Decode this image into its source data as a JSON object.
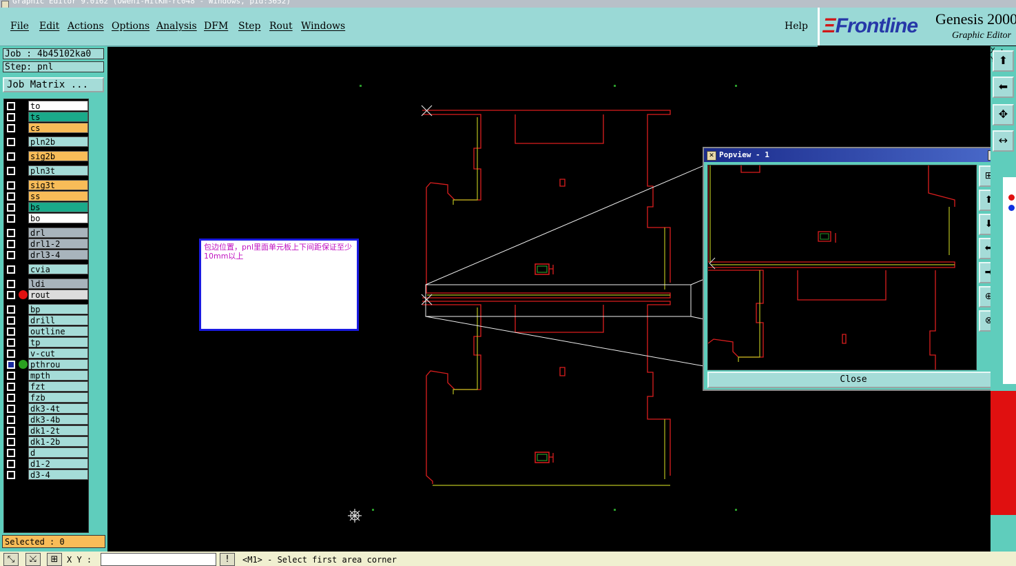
{
  "window": {
    "title": "Graphic Editor 9.0162 (Owen1-HitKm-rc048 - Windows, pid:3652)"
  },
  "menu": {
    "items": [
      "File",
      "Edit",
      "Actions",
      "Options",
      "Analysis",
      "DFM",
      "Step",
      "Rout",
      "Windows"
    ],
    "help": "Help"
  },
  "brand": {
    "logo": "Frontline",
    "product": "Genesis 2000",
    "subtitle": "Graphic Editor"
  },
  "left": {
    "job": "Job : 4b45102ka0",
    "step": "Step: pnl",
    "job_matrix": "Job Matrix ...",
    "selected": "Selected : 0"
  },
  "layers": [
    {
      "name": "to",
      "color": "#ffffff"
    },
    {
      "name": "ts",
      "color": "#1aaa8a"
    },
    {
      "name": "cs",
      "color": "#f8bc58"
    },
    {
      "name": "pln2b",
      "color": "#a5dcd8"
    },
    {
      "name": "sig2b",
      "color": "#f8bc58"
    },
    {
      "name": "pln3t",
      "color": "#a5dcd8"
    },
    {
      "name": "sig3t",
      "color": "#f8bc58"
    },
    {
      "name": "ss",
      "color": "#f8bc58"
    },
    {
      "name": "bs",
      "color": "#1aaa8a"
    },
    {
      "name": "bo",
      "color": "#ffffff"
    },
    {
      "name": "drl",
      "color": "#a8b4bc"
    },
    {
      "name": "drl1-2",
      "color": "#a8b4bc"
    },
    {
      "name": "drl3-4",
      "color": "#a8b4bc"
    },
    {
      "name": "cvia",
      "color": "#a5dcd8"
    },
    {
      "name": "ldi",
      "color": "#a8b4bc"
    },
    {
      "name": "rout",
      "color": "#dcdcdc",
      "dot": "#e01010"
    },
    {
      "name": "bp",
      "color": "#a5dcd8"
    },
    {
      "name": "drill",
      "color": "#a5dcd8"
    },
    {
      "name": "outline",
      "color": "#a5dcd8"
    },
    {
      "name": "tp",
      "color": "#a5dcd8"
    },
    {
      "name": "v-cut",
      "color": "#a5dcd8"
    },
    {
      "name": "pthrou",
      "color": "#a5dcd8",
      "dot": "#2aa020",
      "work": true
    },
    {
      "name": "mpth",
      "color": "#a5dcd8"
    },
    {
      "name": "fzt",
      "color": "#a5dcd8"
    },
    {
      "name": "fzb",
      "color": "#a5dcd8"
    },
    {
      "name": "dk3-4t",
      "color": "#a5dcd8"
    },
    {
      "name": "dk3-4b",
      "color": "#a5dcd8"
    },
    {
      "name": "dk1-2t",
      "color": "#a5dcd8"
    },
    {
      "name": "dk1-2b",
      "color": "#a5dcd8"
    },
    {
      "name": "d",
      "color": "#a5dcd8"
    },
    {
      "name": "d1-2",
      "color": "#a5dcd8"
    },
    {
      "name": "d3-4",
      "color": "#a5dcd8"
    }
  ],
  "note": {
    "text": "包边位置，pnl里面单元板上下间距保证至少10mm以上"
  },
  "popview": {
    "title": "Popview - 1",
    "close_label": "Close"
  },
  "status": {
    "xy_label": "X Y :",
    "xy_value": "",
    "prompt": "<M1> - Select first area corner",
    "excl": "!"
  },
  "coords": {
    "x_label": "X :",
    "y_label": "Y :"
  },
  "colors": {
    "outline_red": "#dc1e1e",
    "outline_yellow": "#b8c020",
    "accent_teal": "#5fcdbc"
  }
}
